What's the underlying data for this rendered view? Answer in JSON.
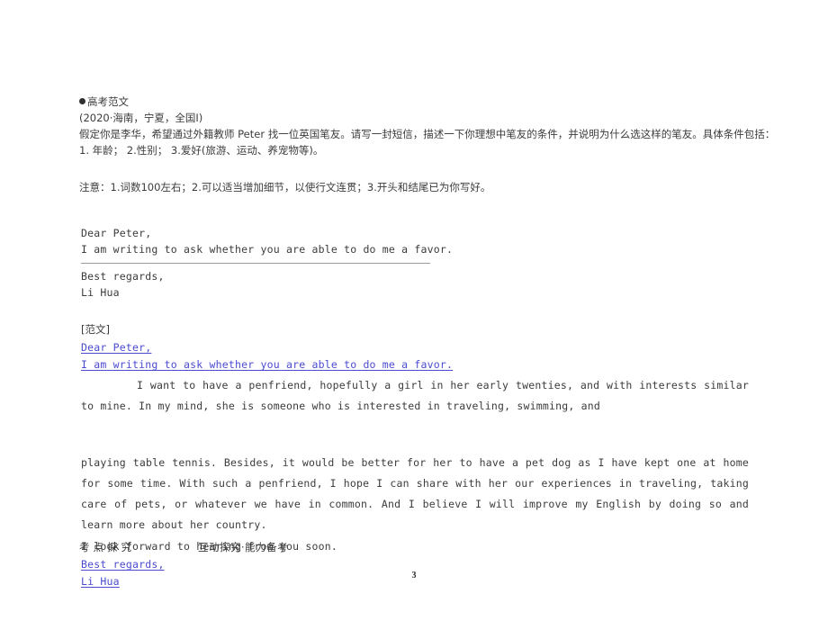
{
  "document": {
    "page_number": "3"
  },
  "prompt": {
    "heading": "高考范文",
    "source": "(2020·海南，宁夏，全国Ⅰ)",
    "task": "假定你是李华，希望通过外籍教师 Peter 找一位英国笔友。请写一封短信，描述一下你理想中笔友的条件，并说明为什么选这样的笔友。具体条件包括：",
    "conditions": "1. 年龄；    2.性别；    3.爱好(旅游、运动、养宠物等)。",
    "notes": "注意：1.词数100左右；2.可以适当增加细节，以使行文连贯；3.开头和结尾已为你写好。"
  },
  "letter_skeleton": {
    "salutation": "Dear Peter,",
    "opening": "I am writing to ask whether you are able to do me a favor.",
    "closing": "Best regards,",
    "signature": "Li Hua"
  },
  "model_answer": {
    "tag": "[范文]",
    "salutation": "Dear Peter,",
    "opening": "I am writing to ask whether you are able to do me a favor.",
    "paragraph_one": "I want to have a penfriend, hopefully a girl in her early twenties, and with interests similar to mine. In my mind, she is someone who is interested in traveling, swimming, and",
    "paragraph_two": "playing table tennis. Besides, it would be better for her to have a pet dog as I have kept one at home for some time. With such a penfriend, I hope I can share with her our experiences in traveling, taking care of pets, or whatever we have in common. And I believe I will improve my English by doing so and learn more about her country.",
    "final_line": "I look forward to hearing from you soon.",
    "closing": "Best regards,",
    "signature": "Li Hua"
  },
  "footer": {
    "left_label": "考点探究",
    "right_label": "互动探究·能力备考"
  },
  "colors": {
    "blue_annotation": "#4b4bd2",
    "body_text": "#3c3c3c",
    "rule": "#9a9a9a"
  }
}
